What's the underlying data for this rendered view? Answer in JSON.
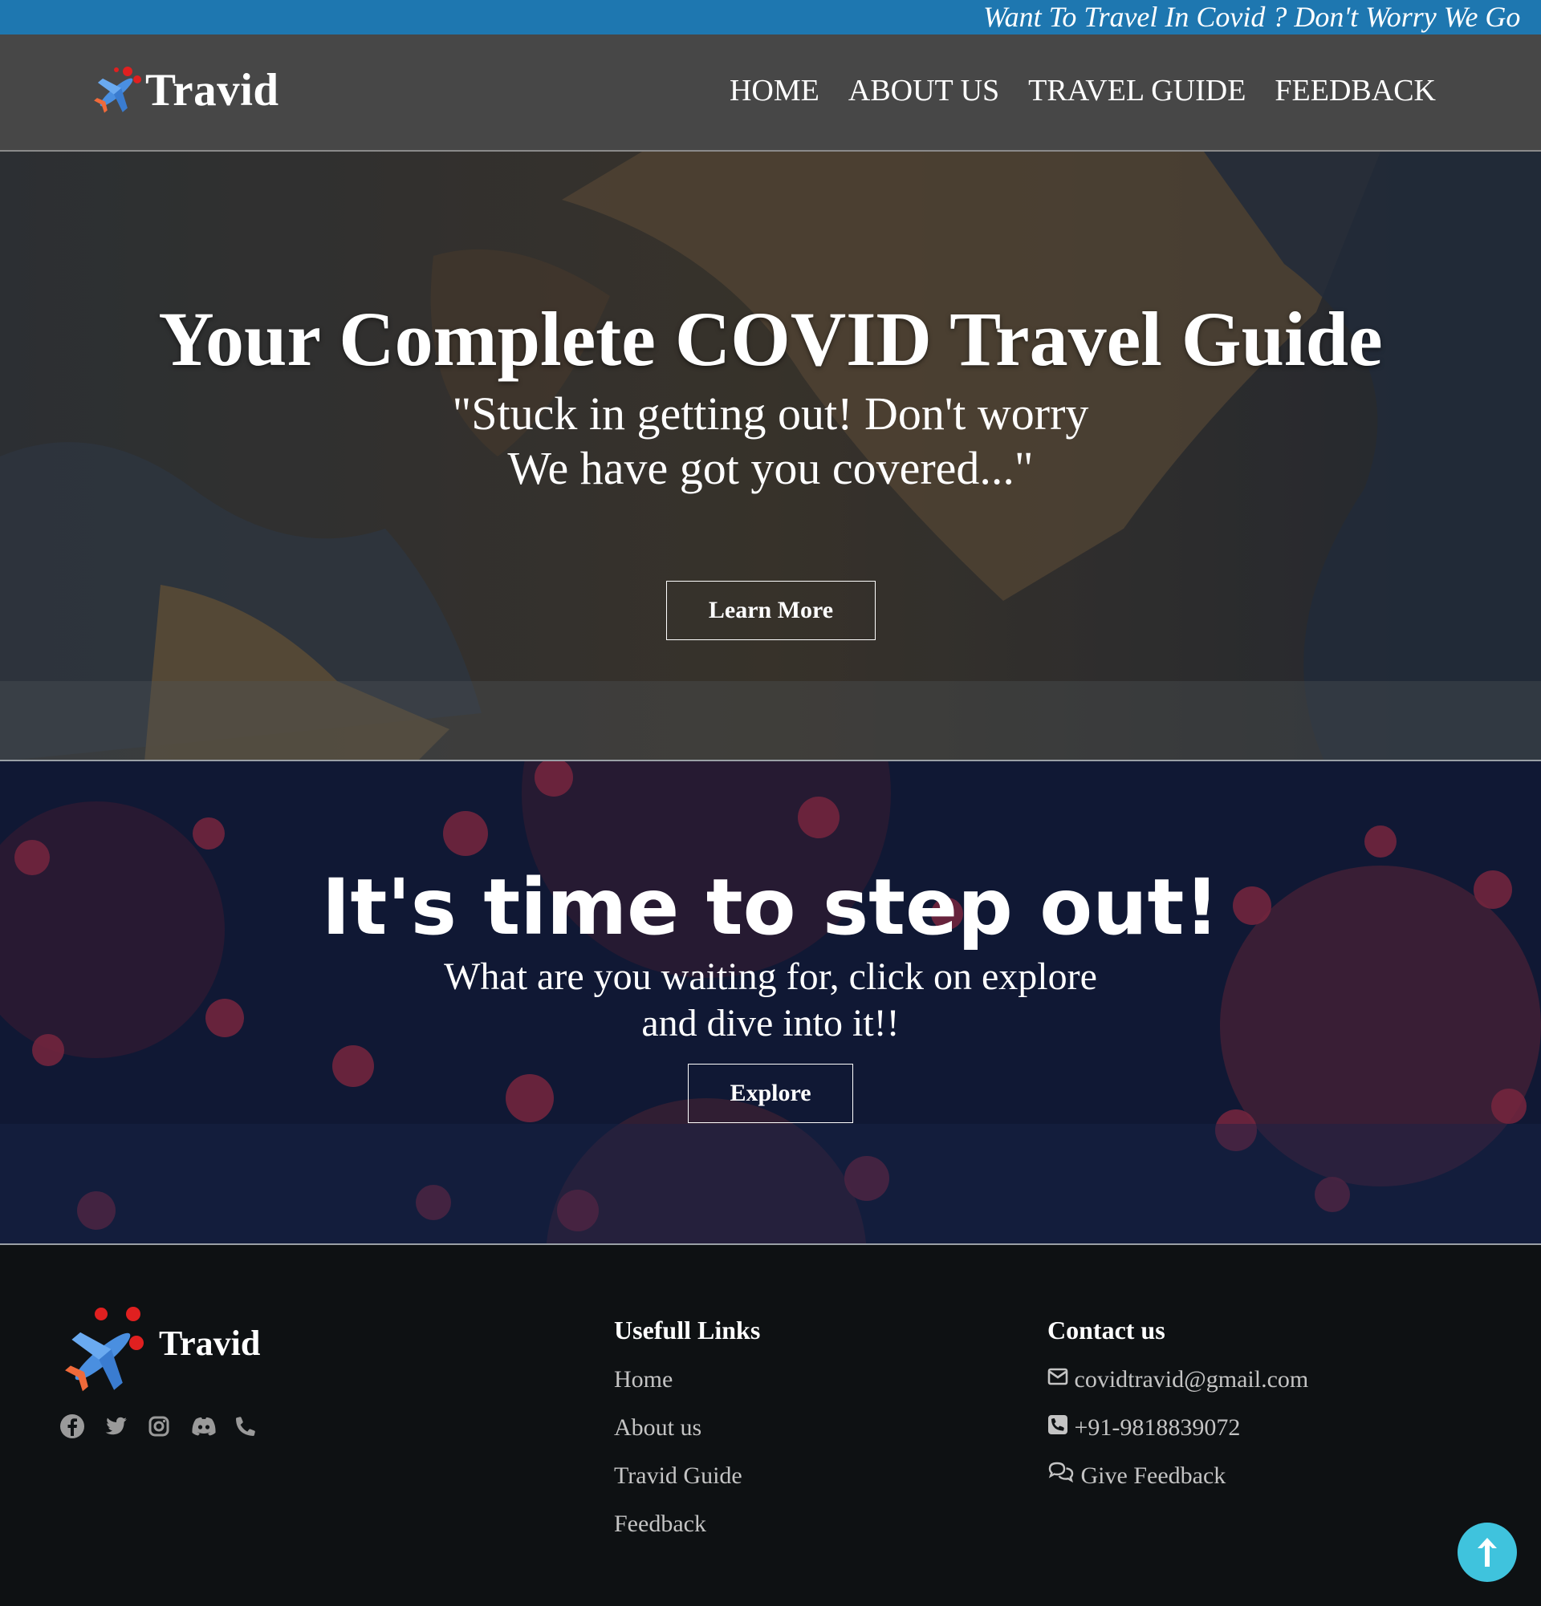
{
  "marquee": {
    "text": "Want To Travel In Covid ? Don't Worry We Go"
  },
  "nav": {
    "brand": "Travid",
    "items": [
      "HOME",
      "ABOUT US",
      "TRAVEL GUIDE",
      "FEEDBACK"
    ]
  },
  "hero": {
    "title": "Your Complete COVID Travel Guide",
    "subtitle_line1": "\"Stuck in getting out! Don't worry",
    "subtitle_line2": "We have got you covered...\"",
    "button": "Learn More"
  },
  "hero2": {
    "title": "It's time to step out!",
    "subtitle_line1": "What are you waiting for, click on explore",
    "subtitle_line2": "and dive into it!!",
    "button": "Explore"
  },
  "footer": {
    "brand": "Travid",
    "socials": [
      "facebook-icon",
      "twitter-icon",
      "instagram-icon",
      "discord-icon",
      "phone-icon"
    ],
    "links_heading": "Usefull Links",
    "links": [
      "Home",
      "About us",
      "Travid Guide",
      "Feedback"
    ],
    "contact_heading": "Contact us",
    "contact": {
      "email": "covidtravid@gmail.com",
      "phone": "+91-9818839072",
      "feedback": "Give Feedback"
    }
  },
  "colors": {
    "marquee_bg": "#1e77b0",
    "navbar_bg": "#474747",
    "footer_bg": "#0e1113",
    "scroll_top_bg": "#3fc3dd"
  }
}
